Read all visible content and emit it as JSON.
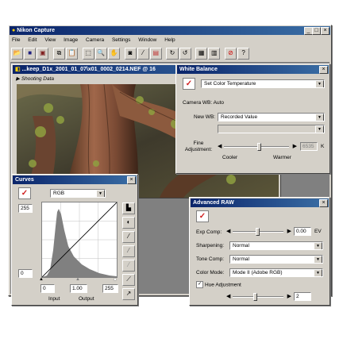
{
  "app": {
    "title": "Nikon Capture",
    "menu": [
      "File",
      "Edit",
      "View",
      "Image",
      "Camera",
      "Settings",
      "Window",
      "Help"
    ],
    "toolbar_icons": [
      "open-icon",
      "save-icon",
      "save-as-icon",
      "copy-icon",
      "paste-icon",
      "select-icon",
      "zoom-icon",
      "hand-icon",
      "camera-icon",
      "brush-icon",
      "color-icon",
      "rotate-cw-icon",
      "rotate-ccw-icon",
      "grid-icon",
      "panel-icon",
      "stop-icon",
      "help-icon"
    ]
  },
  "image_window": {
    "title": "...keep_D1x_2001_01_07\\x01_0002_0214.NEF @ 16",
    "shooting_data_label": "Shooting Data"
  },
  "white_balance": {
    "title": "White Balance",
    "mode": "Set Color Temperature",
    "camera_wb_label": "Camera WB:",
    "camera_wb_value": "Auto",
    "new_wb_label": "New WB:",
    "new_wb_value": "Recorded Value",
    "fine_adjustment_label": "Fine\nAdjustment:",
    "kelvin_value": "6535",
    "kelvin_unit": "K",
    "cooler_label": "Cooler",
    "warmer_label": "Warmer",
    "slider_position": 0.55
  },
  "curves": {
    "title": "Curves",
    "channel": "RGB",
    "output_high": "255",
    "output_low": "0",
    "input_low": "0",
    "gamma": "1.00",
    "input_high": "255",
    "input_label": "Input",
    "output_label": "Output",
    "tools": [
      "histogram-icon",
      "contrast-icon",
      "eyedropper-black-icon",
      "eyedropper-gray-icon",
      "eyedropper-white-icon",
      "curve-linear-icon",
      "curve-reset-icon"
    ]
  },
  "advanced_raw": {
    "title": "Advanced RAW",
    "exp_comp_label": "Exp Comp:",
    "exp_comp_value": "0.00",
    "exp_comp_unit": "EV",
    "sharpening_label": "Sharpening:",
    "sharpening_value": "Normal",
    "tone_comp_label": "Tone Comp:",
    "tone_comp_value": "Normal",
    "color_mode_label": "Color Mode:",
    "color_mode_value": "Mode II (Adobe RGB)",
    "hue_adjustment_label": "Hue Adjustment",
    "hue_value": "2",
    "exp_slider_position": 0.5,
    "hue_slider_position": 0.45
  },
  "colors": {
    "titlebar": "#0a246a",
    "face": "#d4d0c8",
    "check": "#d02020"
  }
}
